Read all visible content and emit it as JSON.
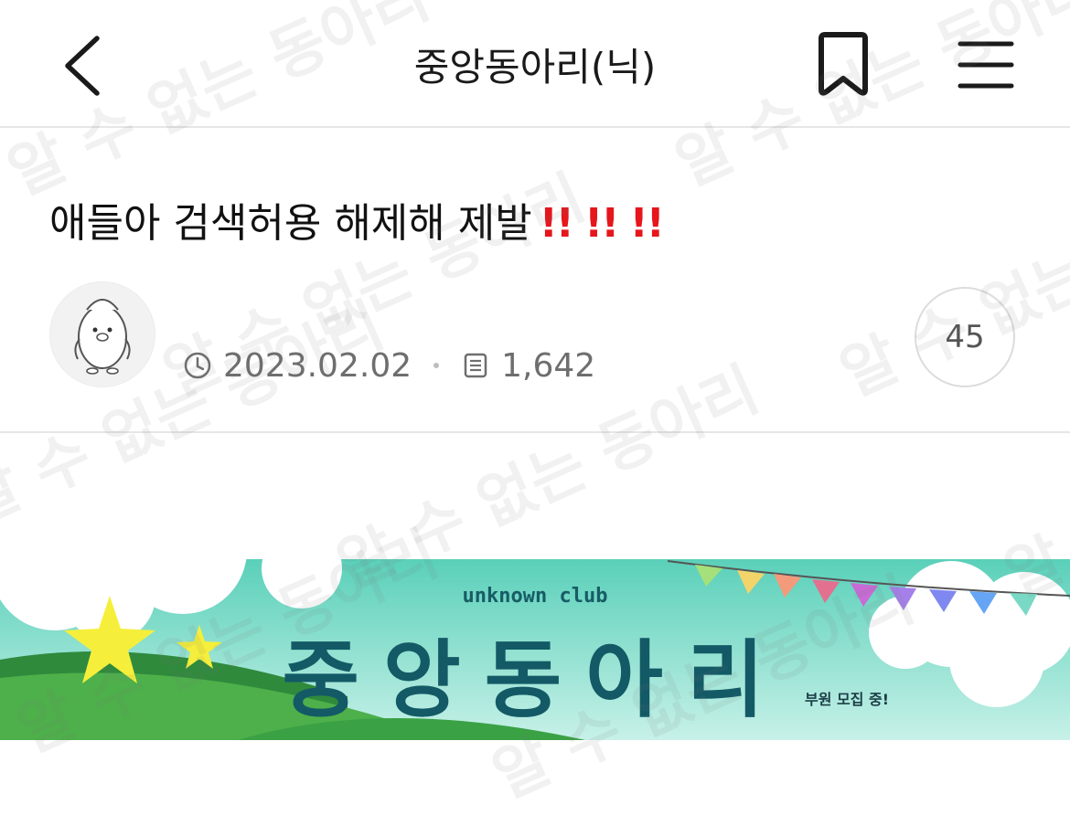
{
  "header": {
    "title": "중앙동아리(닉)"
  },
  "post": {
    "title": "애들아 검색허용 해제해 제발",
    "emphasis": "!! !! !!",
    "date": "2023.02.02",
    "views": "1,642",
    "comments": "45"
  },
  "banner": {
    "brand": "unknown club",
    "title": "중앙동아리",
    "tagline": "부원 모집 중!"
  },
  "watermark": {
    "text": "알 수 없는 동아리"
  },
  "icons": {
    "back": "back-chevron-icon",
    "bookmark": "bookmark-icon",
    "menu": "hamburger-menu-icon",
    "date": "clock-icon",
    "views": "document-icon"
  },
  "colors": {
    "emphasis": "#e5161c",
    "divider": "#e6e6e6",
    "meta_text": "#6e6e6e",
    "banner_text": "#135a66"
  }
}
